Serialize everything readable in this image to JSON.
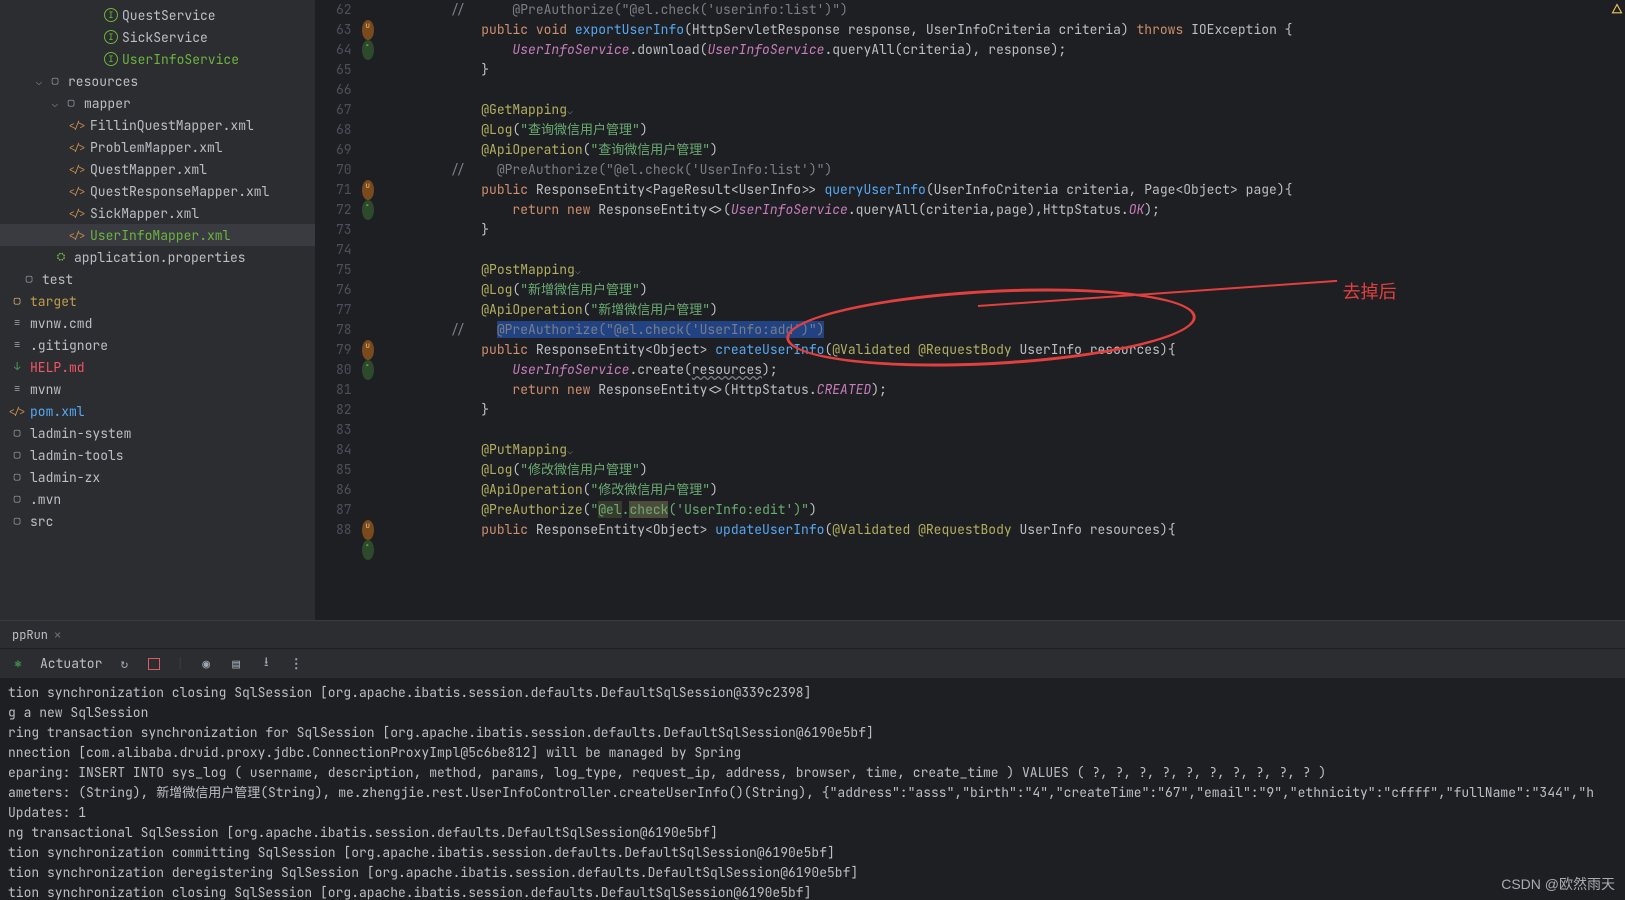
{
  "sidebar": {
    "items": [
      {
        "indent": 96,
        "icon": "int",
        "label": "QuestService",
        "cls": ""
      },
      {
        "indent": 96,
        "icon": "int",
        "label": "SickService",
        "cls": ""
      },
      {
        "indent": 96,
        "icon": "int",
        "label": "UserInfoService",
        "cls": "",
        "hl": "green"
      },
      {
        "indent": 24,
        "icon": "folder",
        "label": "resources",
        "arrow": "down"
      },
      {
        "indent": 40,
        "icon": "folder",
        "label": "mapper",
        "arrow": "down"
      },
      {
        "indent": 60,
        "icon": "xml",
        "label": "FillinQuestMapper.xml"
      },
      {
        "indent": 60,
        "icon": "xml",
        "label": "ProblemMapper.xml"
      },
      {
        "indent": 60,
        "icon": "xml",
        "label": "QuestMapper.xml"
      },
      {
        "indent": 60,
        "icon": "xml",
        "label": "QuestResponseMapper.xml"
      },
      {
        "indent": 60,
        "icon": "xml",
        "label": "SickMapper.xml"
      },
      {
        "indent": 60,
        "icon": "xml",
        "label": "UserInfoMapper.xml",
        "active": true,
        "hl": "green"
      },
      {
        "indent": 44,
        "icon": "prop",
        "label": "application.properties"
      },
      {
        "indent": 12,
        "icon": "folder",
        "label": "test"
      },
      {
        "indent": 0,
        "icon": "target",
        "label": "target",
        "cls": "warn"
      },
      {
        "indent": 0,
        "icon": "file",
        "label": "mvnw.cmd"
      },
      {
        "indent": 0,
        "icon": "file",
        "label": ".gitignore"
      },
      {
        "indent": 0,
        "icon": "md",
        "label": "HELP.md",
        "cls": "error"
      },
      {
        "indent": 0,
        "icon": "file",
        "label": "mvnw"
      },
      {
        "indent": 0,
        "icon": "xml",
        "label": "pom.xml",
        "hl": "blue"
      },
      {
        "indent": 0,
        "icon": "folder",
        "label": "ladmin-system"
      },
      {
        "indent": 0,
        "icon": "folder",
        "label": "ladmin-tools"
      },
      {
        "indent": 0,
        "icon": "folder",
        "label": "ladmin-zx"
      },
      {
        "indent": 0,
        "icon": "folder",
        "label": ".mvn"
      },
      {
        "indent": 0,
        "icon": "folder",
        "label": "src"
      }
    ]
  },
  "editor": {
    "lines": [
      {
        "n": 62,
        "g": "",
        "html": "<span class='c-com'>//      @PreAuthorize(\"@el.check('userinfo:list')\")</span>"
      },
      {
        "n": 63,
        "g": "ur",
        "html": "    <span class='c-kw'>public</span> <span class='c-kw'>void</span> <span class='c-mth'>exportUserInfo</span>(HttpServletResponse response, UserInfoCriteria criteria) <span class='c-kw'>throws</span> IOException {"
      },
      {
        "n": 64,
        "g": "",
        "html": "        <span class='c-fld'>UserInfoService</span>.download(<span class='c-fld'>UserInfoService</span>.queryAll(criteria), response);"
      },
      {
        "n": 65,
        "g": "",
        "html": "    }"
      },
      {
        "n": 66,
        "g": "",
        "html": ""
      },
      {
        "n": 67,
        "g": "",
        "html": "    <span class='c-ann'>@GetMapping</span><span class='caret-icon'>⌵</span>"
      },
      {
        "n": 68,
        "g": "",
        "html": "    <span class='c-ann'>@Log</span>(<span class='c-str'>\"查询微信用户管理\"</span>)"
      },
      {
        "n": 69,
        "g": "",
        "html": "    <span class='c-ann'>@ApiOperation</span>(<span class='c-str'>\"查询微信用户管理\"</span>)"
      },
      {
        "n": 70,
        "g": "",
        "html": "<span class='c-com'>//    @PreAuthorize(\"@el.check('UserInfo:list')\")</span>"
      },
      {
        "n": 71,
        "g": "ur",
        "html": "    <span class='c-kw'>public</span> ResponseEntity&lt;PageResult&lt;UserInfo&gt;&gt; <span class='c-mth'>queryUserInfo</span>(UserInfoCriteria criteria, Page&lt;Object&gt; page){"
      },
      {
        "n": 72,
        "g": "",
        "html": "        <span class='c-kw'>return</span> <span class='c-kw'>new</span> ResponseEntity&lt;&gt;(<span class='c-fld'>UserInfoService</span>.queryAll(criteria,page),HttpStatus.<span class='c-fld'>OK</span>);"
      },
      {
        "n": 73,
        "g": "",
        "html": "    }"
      },
      {
        "n": 74,
        "g": "",
        "html": ""
      },
      {
        "n": 75,
        "g": "",
        "html": "    <span class='c-ann'>@PostMapping</span><span class='caret-icon'>⌵</span>"
      },
      {
        "n": 76,
        "g": "",
        "html": "    <span class='c-ann'>@Log</span>(<span class='c-str'>\"新增微信用户管理\"</span>)"
      },
      {
        "n": 77,
        "g": "",
        "html": "    <span class='c-ann'>@ApiOperation</span>(<span class='c-str'>\"新增微信用户管理\"</span>)"
      },
      {
        "n": 78,
        "g": "",
        "html": "<span class='c-com'>//    </span><span class='sel c-com'>@PreAuthorize(\"@el.check('UserInfo:add')\")</span>"
      },
      {
        "n": 79,
        "g": "ur",
        "html": "    <span class='c-kw'>public</span> ResponseEntity&lt;Object&gt; <span class='c-mth'>createUserInfo</span>(<span class='c-ann'>@Validated</span> <span class='c-ann'>@RequestBody</span> UserInfo resources){"
      },
      {
        "n": 80,
        "g": "",
        "html": "        <span class='c-fld'>UserInfoService</span>.create(<span class='warn-u'>resources</span>);"
      },
      {
        "n": 81,
        "g": "",
        "html": "        <span class='c-kw'>return</span> <span class='c-kw'>new</span> ResponseEntity&lt;&gt;(HttpStatus.<span class='c-fld'>CREATED</span>);"
      },
      {
        "n": 82,
        "g": "",
        "html": "    }"
      },
      {
        "n": 83,
        "g": "",
        "html": ""
      },
      {
        "n": 84,
        "g": "",
        "html": "    <span class='c-ann'>@PutMapping</span><span class='caret-icon'>⌵</span>"
      },
      {
        "n": 85,
        "g": "",
        "html": "    <span class='c-ann'>@Log</span>(<span class='c-str'>\"修改微信用户管理\"</span>)"
      },
      {
        "n": 86,
        "g": "",
        "html": "    <span class='c-ann'>@ApiOperation</span>(<span class='c-str'>\"修改微信用户管理\"</span>)"
      },
      {
        "n": 87,
        "g": "",
        "html": "    <span class='c-ann'>@PreAuthorize</span>(<span class='c-str'>\"</span><span class='hl-bg c-str'>@el</span><span class='c-str'>.</span><span class='warn-bg c-str'>check</span><span class='c-str'>(</span><span class='c-str'>'UserInfo:edit'</span><span class='c-str'>)</span><span class='c-str'>\"</span>)"
      },
      {
        "n": 88,
        "g": "ur",
        "html": "    <span class='c-kw'>public</span> ResponseEntity&lt;Object&gt; <span class='c-mth'>updateUserInfo</span>(<span class='c-ann'>@Validated</span> <span class='c-ann'>@RequestBody</span> UserInfo resources){"
      }
    ]
  },
  "annotation": {
    "text": "去掉后"
  },
  "bottom": {
    "tab": "ppRun",
    "actuator": "Actuator",
    "console": [
      "tion synchronization closing SqlSession [org.apache.ibatis.session.defaults.DefaultSqlSession@339c2398]",
      "g a new SqlSession",
      "ring transaction synchronization for SqlSession [org.apache.ibatis.session.defaults.DefaultSqlSession@6190e5bf]",
      "nnection [com.alibaba.druid.proxy.jdbc.ConnectionProxyImpl@5c6be812] will be managed by Spring",
      "eparing: INSERT INTO sys_log ( username, description, method, params, log_type, request_ip, address, browser, time, create_time ) VALUES ( ?, ?, ?, ?, ?, ?, ?, ?, ?, ? )",
      "ameters: (String), 新增微信用户管理(String), me.zhengjie.rest.UserInfoController.createUserInfo()(String), {\"address\":\"asss\",\"birth\":\"4\",\"createTime\":\"67\",\"email\":\"9\",\"ethnicity\":\"cffff\",\"fullName\":\"344\",\"h",
      "Updates: 1",
      "ng transactional SqlSession [org.apache.ibatis.session.defaults.DefaultSqlSession@6190e5bf]",
      "tion synchronization committing SqlSession [org.apache.ibatis.session.defaults.DefaultSqlSession@6190e5bf]",
      "tion synchronization deregistering SqlSession [org.apache.ibatis.session.defaults.DefaultSqlSession@6190e5bf]",
      "tion synchronization closing SqlSession [org.apache.ibatis.session.defaults.DefaultSqlSession@6190e5bf]"
    ]
  },
  "watermark": "CSDN @欧然雨天"
}
